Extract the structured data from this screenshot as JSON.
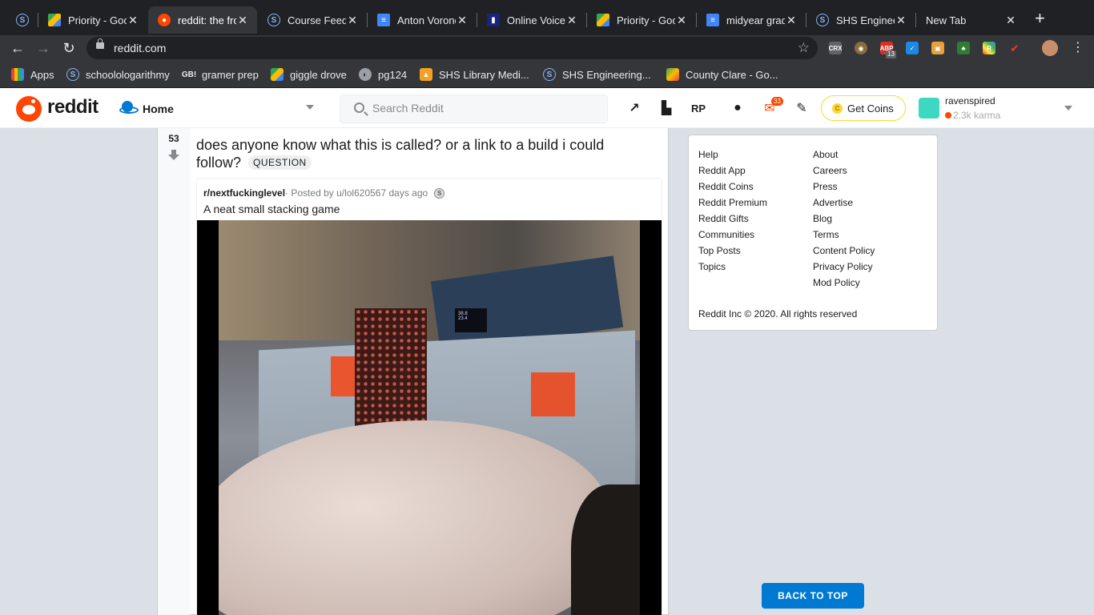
{
  "browser": {
    "tabs": [
      {
        "title": "",
        "icon": "s-icon",
        "active": false
      },
      {
        "title": "Priority - Goo",
        "icon": "drive-icon",
        "active": false
      },
      {
        "title": "reddit: the fro",
        "icon": "reddit-icon",
        "active": true
      },
      {
        "title": "Course Feedb",
        "icon": "s-icon",
        "active": false
      },
      {
        "title": "Anton Vorono",
        "icon": "docs-icon",
        "active": false
      },
      {
        "title": "Online Voice",
        "icon": "voice-icon",
        "active": false
      },
      {
        "title": "Priority - Goo",
        "icon": "drive-icon",
        "active": false
      },
      {
        "title": "midyear grad",
        "icon": "docs-icon",
        "active": false
      },
      {
        "title": "SHS Enginee",
        "icon": "s-icon",
        "active": false
      },
      {
        "title": "New Tab",
        "icon": "",
        "active": false
      }
    ],
    "url": "reddit.com",
    "extension_badge": "13",
    "bookmarks": [
      {
        "label": "Apps",
        "icon": "apps-grid-icon"
      },
      {
        "label": "schoolologarithmy",
        "icon": "s-icon"
      },
      {
        "label": "gramer prep",
        "icon": "gb-icon"
      },
      {
        "label": "giggle drove",
        "icon": "drive-icon"
      },
      {
        "label": "pg124",
        "icon": "globe-icon"
      },
      {
        "label": "SHS Library Medi...",
        "icon": "library-icon"
      },
      {
        "label": "SHS Engineering...",
        "icon": "s-icon"
      },
      {
        "label": "County Clare - Go...",
        "icon": "maps-icon"
      }
    ]
  },
  "reddit_header": {
    "wordmark": "reddit",
    "feed_label": "Home",
    "search_placeholder": "Search Reddit",
    "mail_badge": "33",
    "get_coins": "Get Coins",
    "username": "ravenspired",
    "karma": "2.3k karma"
  },
  "post": {
    "score": "53",
    "title": "does anyone know what this is called? or a link to a build i could follow?",
    "flair": "QUESTION",
    "crosspost": {
      "subreddit": "r/nextfuckinglevel",
      "posted_by": " · Posted by u/lol62056",
      "age": " 7 days ago",
      "title": "A neat small stacking game"
    },
    "oled_text": "38.8\n23.4"
  },
  "footer": {
    "col1": [
      "Help",
      "Reddit App",
      "Reddit Coins",
      "Reddit Premium",
      "Reddit Gifts",
      "Communities",
      "Top Posts",
      "Topics"
    ],
    "col2": [
      "About",
      "Careers",
      "Press",
      "Advertise",
      "Blog",
      "Terms",
      "Content Policy",
      "Privacy Policy",
      "Mod Policy"
    ],
    "copyright": "Reddit Inc © 2020. All rights reserved",
    "back_to_top": "BACK TO TOP"
  }
}
